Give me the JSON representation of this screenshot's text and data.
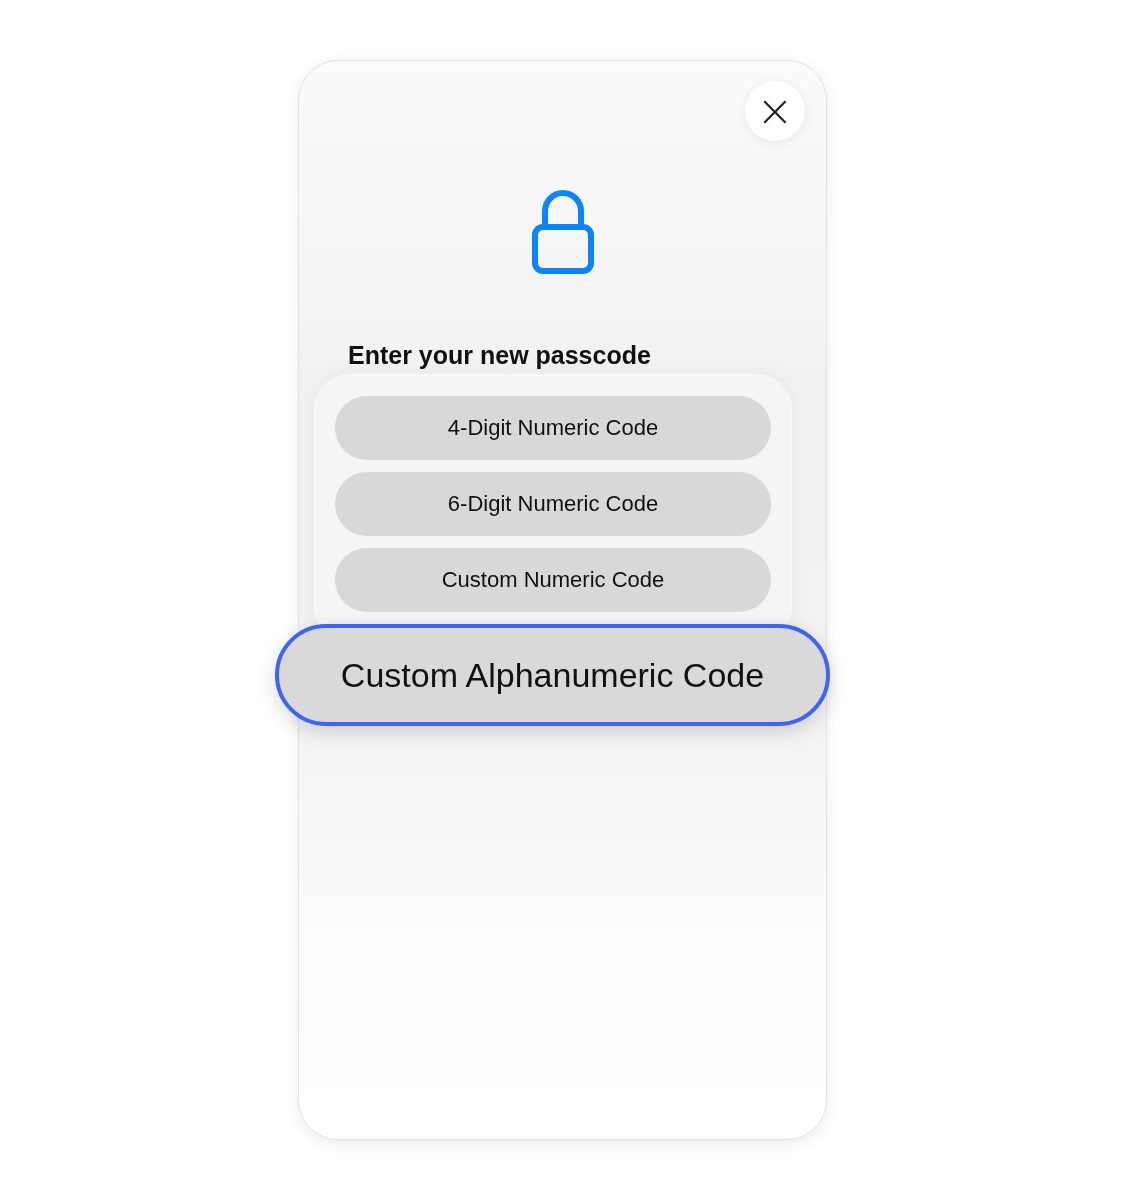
{
  "close_button": {
    "label": "×"
  },
  "title": "Enter your new passcode",
  "passcode_options": [
    {
      "label": "4-Digit Numeric Code",
      "selected": false
    },
    {
      "label": "6-Digit Numeric Code",
      "selected": false
    },
    {
      "label": "Custom Numeric Code",
      "selected": false
    },
    {
      "label": "Custom Alphanumeric Code",
      "selected": true
    }
  ]
}
